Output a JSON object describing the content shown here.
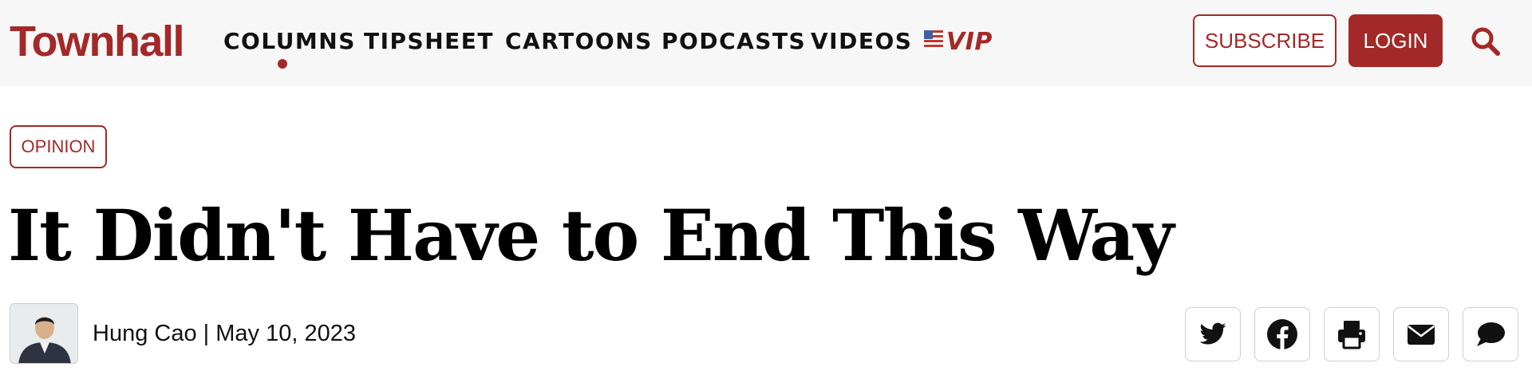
{
  "brand": {
    "logo_text": "Townhall",
    "accent_color": "#a32929"
  },
  "nav": {
    "items": [
      {
        "label": "COLUMNS",
        "active": true
      },
      {
        "label": "TIPSHEET",
        "active": false
      },
      {
        "label": "CARTOONS",
        "active": false
      },
      {
        "label": "PODCASTS",
        "active": false
      },
      {
        "label": "VIDEOS",
        "active": false
      }
    ],
    "vip_label": "VIP",
    "vip_icon": "us-flag-icon"
  },
  "header_actions": {
    "subscribe_label": "SUBSCRIBE",
    "login_label": "LOGIN",
    "search_icon": "search-icon"
  },
  "article": {
    "category": "OPINION",
    "title": "It Didn't Have to End This Way",
    "byline": "Hung Cao | May 10, 2023",
    "author_avatar": "author-photo"
  },
  "share": {
    "icons": [
      "twitter-icon",
      "facebook-icon",
      "print-icon",
      "email-icon",
      "comment-icon"
    ]
  }
}
